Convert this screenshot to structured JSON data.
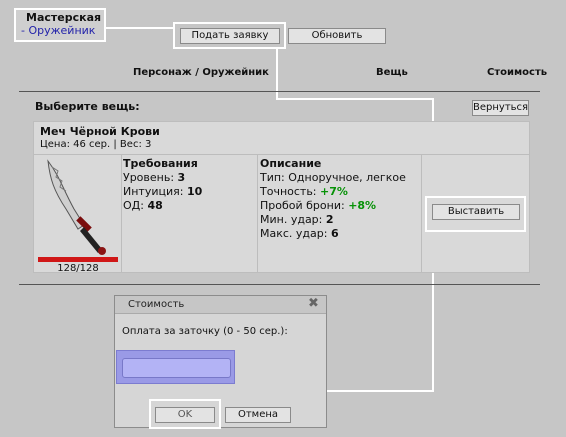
{
  "workshop": {
    "title": "Мастерская",
    "current": "- Оружейник"
  },
  "toolbar": {
    "submit_label": "Подать заявку",
    "refresh_label": "Обновить"
  },
  "columns": {
    "character_label": "Персонаж / Оружейник",
    "item_label": "Вещь",
    "cost_label": "Стоимость"
  },
  "select": {
    "heading": "Выберите вещь:",
    "back_label": "Вернуться"
  },
  "item": {
    "name": "Меч Чёрной Крови",
    "price_line": "Цена: 46 сер. | Вес: 3",
    "durability": "128/128",
    "durability_fraction": 1.0,
    "requirements": {
      "heading": "Требования",
      "level_label": "Уровень: ",
      "level_value": "3",
      "intuition_label": "Интуиция: ",
      "intuition_value": "10",
      "od_label": "ОД: ",
      "od_value": "48"
    },
    "description": {
      "heading": "Описание",
      "type_line": "Тип: Одноручное, легкое",
      "accuracy_label": "Точность: ",
      "accuracy_value": "+7%",
      "armor_pierce_label": "Пробой брони: ",
      "armor_pierce_value": "+8%",
      "min_hit_label": "Мин. удар: ",
      "min_hit_value": "2",
      "max_hit_label": "Макс. удар: ",
      "max_hit_value": "6"
    },
    "expose_label": "Выставить"
  },
  "dialog": {
    "title": "Стоимость",
    "prompt": "Оплата за заточку (0 - 50 сер.):",
    "input_value": "",
    "ok_label": "OK",
    "cancel_label": "Отмена"
  },
  "colors": {
    "background": "#c6c6c6",
    "panel": "#d9d9d9",
    "highlight": "#ffffff",
    "input_bg": "#b3b3f5",
    "link": "#2222aa",
    "positive": "#079207"
  }
}
